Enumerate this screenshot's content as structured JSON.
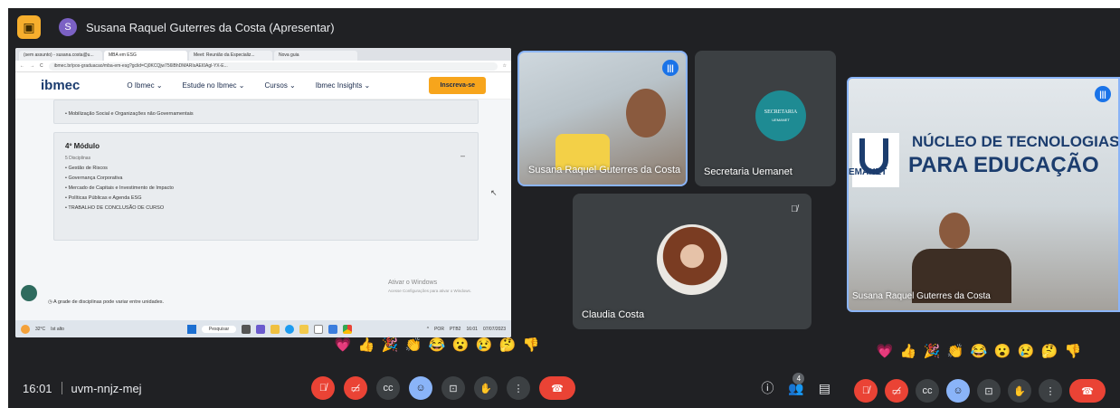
{
  "topbar": {
    "presenter_initial": "S",
    "presenter_label": "Susana Raquel Guterres da Costa (Apresentar)"
  },
  "shared_screen": {
    "tabs": [
      "(sem assunto) - susana.costa@u...",
      "MBA em ESG",
      "Meet: Reunião da Especializ...",
      "Nova guia"
    ],
    "url": "ibmec.br/pos-graduacao/mba-em-esg?gclid=Cj0KCQjw756lBhDMARIsAEI0Agl-YX-E...",
    "site": {
      "logo": "ibmec",
      "nav": [
        "O Ibmec ⌄",
        "Estude no Ibmec ⌄",
        "Cursos ⌄",
        "Ibmec Insights ⌄"
      ],
      "cta": "Inscreva-se"
    },
    "prev_module_item": "Mobilização Social e Organizações não Governamentais",
    "module": {
      "title": "4º Módulo",
      "subtitle": "5 Disciplinas",
      "items": [
        "Gestão de Riscos",
        "Governança Corporativa",
        "Mercado de Capitais e Investimento de Impacto",
        "Políticas Públicas e Agenda ESG",
        "TRABALHO DE CONCLUSÃO DE CURSO"
      ]
    },
    "footnote": "A grade de disciplinas pode variar entre unidades.",
    "watermark_title": "Ativar o Windows",
    "watermark_sub": "Acesse Configurações para ativar o Windows.",
    "taskbar": {
      "weather": "32°C",
      "weather_sub": "Ist alto",
      "search": "Pesquisar",
      "lang": "POR",
      "lang2": "PTB2",
      "time": "16:01",
      "date": "07/07/2023"
    }
  },
  "tiles": [
    {
      "name": "Susana Raquel Guterres da Costa"
    },
    {
      "name": "Secretaria Uemanet",
      "logo_text": "SECRETARIA",
      "logo_sub": "UEMANET"
    },
    {
      "name": "Claudia Costa"
    }
  ],
  "reactions": [
    "💗",
    "👍",
    "🎉",
    "👏",
    "😂",
    "😮",
    "😢",
    "🤔",
    "👎"
  ],
  "bottombar": {
    "time": "16:01",
    "meeting_code": "uvm-nnjz-mej",
    "participants_count": "4"
  },
  "second_window": {
    "wall_text_line1": "NÚCLEO DE TECNOLOGIAS",
    "wall_text_line2": "PARA EDUCAÇÃO",
    "wall_text_left": "EMANET",
    "tile_name": "Susana Raquel Guterres da Costa"
  },
  "colors": {
    "meet_bg": "#202124",
    "end_call": "#ea4335",
    "speaking": "#1a73e8",
    "ibmec_cta": "#f7a51c"
  }
}
